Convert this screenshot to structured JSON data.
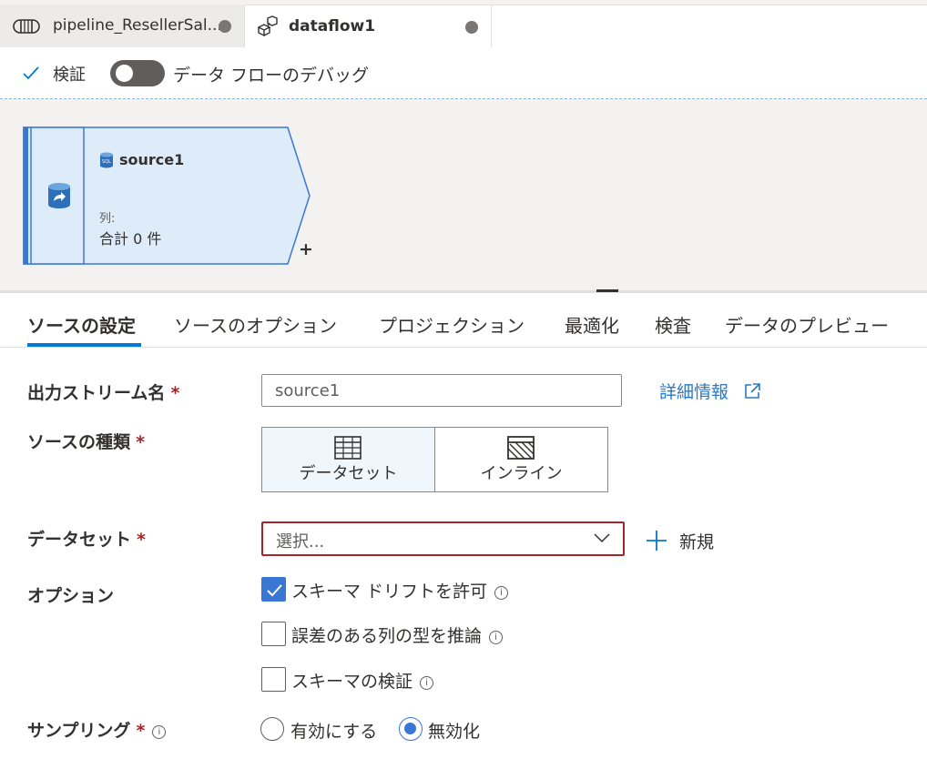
{
  "tabs": [
    {
      "label": "pipeline_ResellerSal...",
      "icon": "pipeline-icon"
    },
    {
      "label": "dataflow1",
      "icon": "dataflow-icon"
    }
  ],
  "toolbar": {
    "validate_label": "検証",
    "debug_label": "データ フローのデバッグ",
    "debug_on": false
  },
  "canvas": {
    "node": {
      "title": "source1",
      "columns_label": "列:",
      "columns_value": "合計 0 件",
      "add": "+"
    }
  },
  "settings_tabs": [
    "ソースの設定",
    "ソースのオプション",
    "プロジェクション",
    "最適化",
    "検査",
    "データのプレビュー"
  ],
  "form": {
    "stream_name_label": "出力ストリーム名",
    "stream_name_value": "source1",
    "learn_more": "詳細情報",
    "source_type_label": "ソースの種類",
    "source_type_dataset": "データセット",
    "source_type_inline": "インライン",
    "dataset_label": "データセット",
    "dataset_placeholder": "選択...",
    "new_label": "新規",
    "options_label": "オプション",
    "option_schema_drift": "スキーマ ドリフトを許可",
    "option_infer_types": "誤差のある列の型を推論",
    "option_validate_schema": "スキーマの検証",
    "sampling_label": "サンプリング",
    "sampling_enable": "有効にする",
    "sampling_disable": "無効化",
    "required_mark": "*"
  },
  "colors": {
    "accent": "#0078d4",
    "checkbox": "#3a77d4",
    "error_border": "#a4262c",
    "node_fill": "#deecf9",
    "node_border": "#3a77d4"
  }
}
